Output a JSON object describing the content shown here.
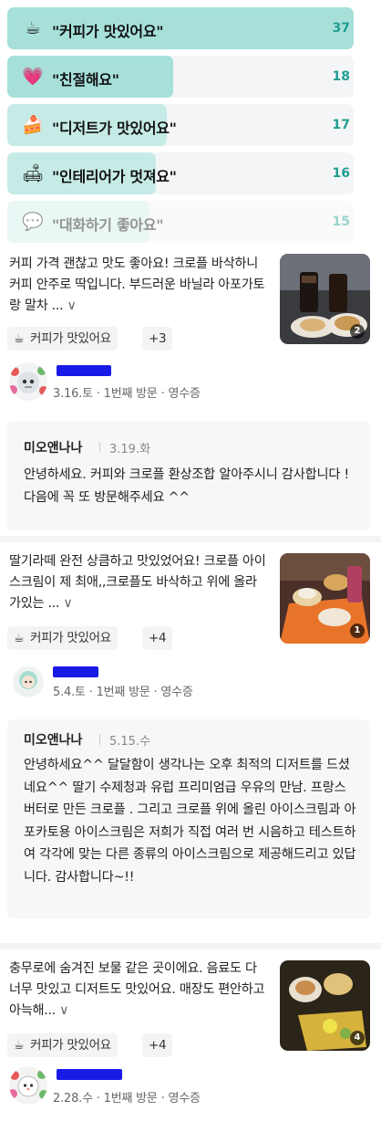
{
  "keywords": [
    {
      "emoji": "☕",
      "icon": "coffee-icon",
      "label": "\"커피가 맛있어요\"",
      "count": "37",
      "fraction": 1.0
    },
    {
      "emoji": "💗",
      "icon": "heart-icon",
      "label": "\"친절해요\"",
      "count": "18",
      "fraction": 0.48
    },
    {
      "emoji": "🍰",
      "icon": "cake-icon",
      "label": "\"디저트가 맛있어요\"",
      "count": "17",
      "fraction": 0.46
    },
    {
      "emoji": "🛋",
      "icon": "sofa-icon",
      "label": "\"인테리어가 멋져요\"",
      "count": "16",
      "fraction": 0.43
    },
    {
      "emoji": "💬",
      "icon": "chat-icon",
      "label": "\"대화하기 좋아요\"",
      "count": "15",
      "fraction": 0.41
    }
  ],
  "reviews": [
    {
      "text": "커피 가격 괜찮고 맛도 좋아요! 크로플 바삭하니 커피 안주로 딱입니다. 부드러운 바닐라 아포가토랑 말차 ...",
      "more": "∨",
      "photo_count": "2",
      "chip_label": "커피가 맛있어요",
      "chip_more": "+3",
      "meta": "3.16.토 · 1번째 방문 · 영수증",
      "reply": {
        "owner": "미오앤나나",
        "date": "3.19.화",
        "body": "안녕하세요. 커피와 크로플 환상조합 알아주시니 감사합니다 ! 다음에 꼭 또 방문해주세요 ^^"
      }
    },
    {
      "text": "딸기라떼 완전 상큼하고 맛있었어요! 크로플 아이스크림이 제 최애,,크로플도 바삭하고 위에 올라가있는 ...",
      "more": "∨",
      "photo_count": "1",
      "chip_label": "커피가 맛있어요",
      "chip_more": "+4",
      "meta": "5.4.토 · 1번째 방문 · 영수증",
      "reply": {
        "owner": "미오앤나나",
        "date": "5.15.수",
        "body": "안녕하세요^^ 달달함이 생각나는 오후 최적의 디저트를 드셨네요^^ 딸기 수제청과 유럽 프리미엄급 우유의 만남. 프랑스 버터로 만든 크로플 . 그리고 크로플 위에 올린 아이스크림과 아포카토용 아이스크림은 저희가 직접 여러 번 시음하고 테스트하여 각각에 맞는 다른 종류의 아이스크림으로 제공해드리고 있답니다. 감사합니다~!!"
      }
    },
    {
      "text": "충무로에 숨겨진 보물 같은 곳이에요. 음료도 다 너무 맛있고 디저트도 맛있어요. 매장도 편안하고 아늑해...",
      "more": "∨",
      "photo_count": "4",
      "chip_label": "커피가 맛있어요",
      "chip_more": "+4",
      "meta": "2.28.수 · 1번째 방문 · 영수증"
    }
  ]
}
